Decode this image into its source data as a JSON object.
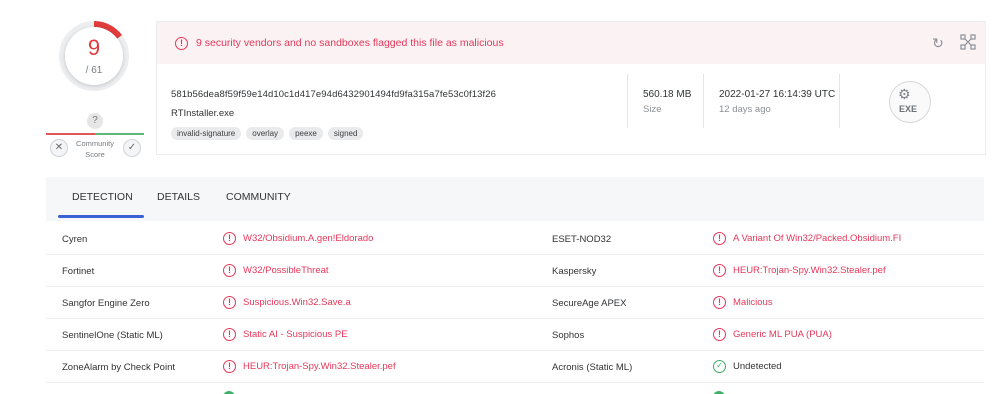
{
  "score": {
    "detections": "9",
    "total": "/ 61",
    "fraction": 0.1475,
    "colors": {
      "positive": "#e03c3c",
      "track": "#eceef0"
    }
  },
  "community": {
    "unknown_badge": "?",
    "label": "Community Score",
    "vote_negative_icon": "close-icon",
    "vote_positive_icon": "check-icon"
  },
  "alert": {
    "icon": "alert-circle-icon",
    "text": "9 security vendors and no sandboxes flagged this file as malicious",
    "color": "#e5385a"
  },
  "toolbar": {
    "reanalyze_icon": "refresh-icon",
    "similar_icon": "graph-expand-icon"
  },
  "file": {
    "hash": "581b56dea8f59f59e14d10c1d417e94d6432901494fd9fa315a7fe53c0f13f26",
    "name": "RTInstaller.exe",
    "tags": [
      "invalid-signature",
      "overlay",
      "peexe",
      "signed"
    ],
    "size_value": "560.18 MB",
    "size_label": "Size",
    "date_value": "2022-01-27 16:14:39 UTC",
    "date_label": "12 days ago",
    "type_badge": "EXE"
  },
  "tabs": [
    {
      "label": "DETECTION",
      "active": true
    },
    {
      "label": "DETAILS",
      "active": false
    },
    {
      "label": "COMMUNITY",
      "active": false
    }
  ],
  "detections": [
    {
      "left": {
        "vendor": "Cyren",
        "result": "W32/Obsidium.A.gen!Eldorado",
        "status": "malicious"
      },
      "right": {
        "vendor": "ESET-NOD32",
        "result": "A Variant Of Win32/Packed.Obsidium.FI",
        "status": "malicious"
      }
    },
    {
      "left": {
        "vendor": "Fortinet",
        "result": "W32/PossibleThreat",
        "status": "malicious"
      },
      "right": {
        "vendor": "Kaspersky",
        "result": "HEUR:Trojan-Spy.Win32.Stealer.pef",
        "status": "malicious"
      }
    },
    {
      "left": {
        "vendor": "Sangfor Engine Zero",
        "result": "Suspicious.Win32.Save.a",
        "status": "malicious"
      },
      "right": {
        "vendor": "SecureAge APEX",
        "result": "Malicious",
        "status": "malicious"
      }
    },
    {
      "left": {
        "vendor": "SentinelOne (Static ML)",
        "result": "Static AI - Suspicious PE",
        "status": "malicious"
      },
      "right": {
        "vendor": "Sophos",
        "result": "Generic ML PUA (PUA)",
        "status": "malicious"
      }
    },
    {
      "left": {
        "vendor": "ZoneAlarm by Check Point",
        "result": "HEUR:Trojan-Spy.Win32.Stealer.pef",
        "status": "malicious"
      },
      "right": {
        "vendor": "Acronis (Static ML)",
        "result": "Undetected",
        "status": "undetected"
      }
    }
  ]
}
